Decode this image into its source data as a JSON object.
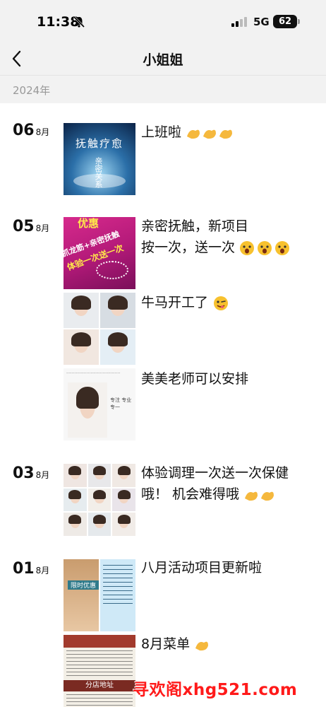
{
  "status_bar": {
    "time": "11:38",
    "network": "5G",
    "battery": "62"
  },
  "nav": {
    "title": "小姐姐"
  },
  "year": "2024年",
  "posts": [
    {
      "day": "06",
      "month": "8月",
      "text": "上班啦",
      "thumb_caption": "抚触疗愈",
      "thumb_sub": "亲密关系"
    },
    {
      "day": "05",
      "month": "8月",
      "text_line1": "亲密抚触，新项目",
      "text_line2": "按一次，送一次",
      "thumb_caption_top": "优惠",
      "thumb_caption_mid": "抓龙筋+亲密抚触",
      "thumb_caption_bot": "体验一次送一次"
    },
    {
      "text": "牛马开工了"
    },
    {
      "text": "美美老师可以安排",
      "thumb_caption": "专注 专业 专一"
    },
    {
      "day": "03",
      "month": "8月",
      "text_line1": "体验调理一次送一次保健",
      "text_line2": "哦！ 机会难得哦"
    },
    {
      "day": "01",
      "month": "8月",
      "text": "八月活动项目更新啦",
      "thumb_caption": "限时优惠"
    },
    {
      "text": "8月菜单",
      "thumb_caption": "分店地址"
    }
  ],
  "watermark": "寻欢阁xhg521.com",
  "colors": {
    "header_bg": "#f2f2f2",
    "watermark": "#ff1a1a"
  }
}
